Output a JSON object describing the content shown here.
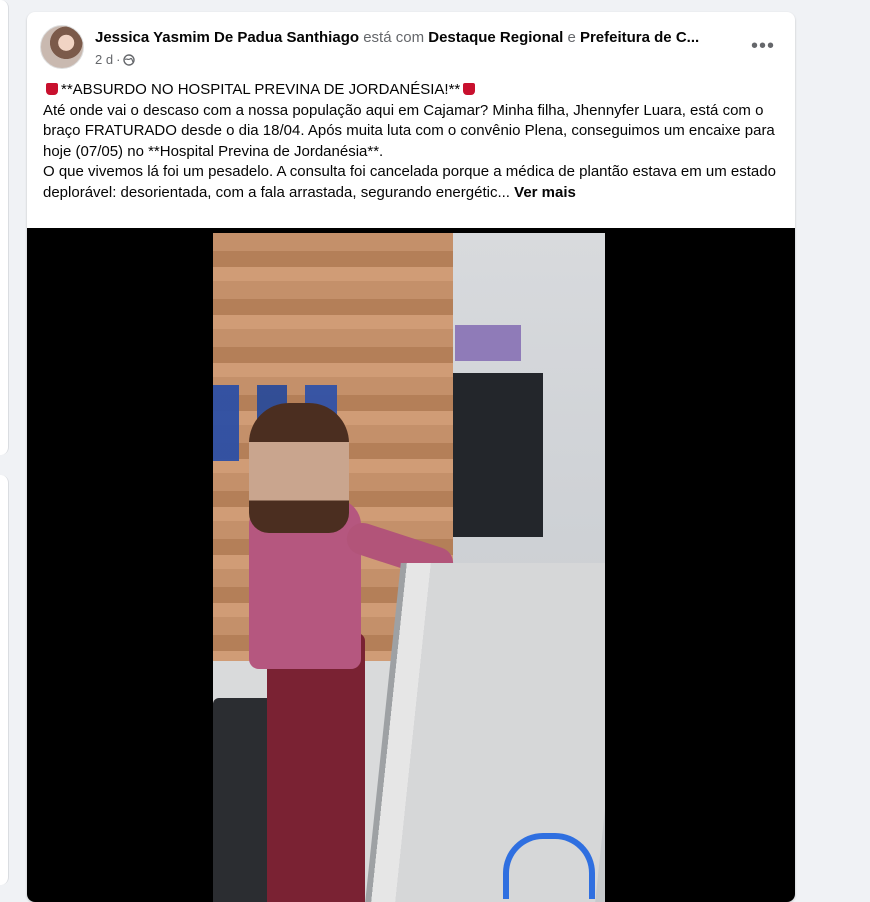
{
  "post": {
    "author": "Jessica Yasmim De Padua Santhiago",
    "with_text": "está com",
    "tag1": "Destaque Regional",
    "and_text": "e",
    "tag2": "Prefeitura de C...",
    "time": "2 d",
    "time_sep": "·",
    "privacy_icon": "globe-icon",
    "more_icon": "more-horizontal-icon",
    "more_label": "•••",
    "headline": "**ABSURDO NO HOSPITAL PREVINA DE JORDANÉSIA!**",
    "paragraph1": "Até onde vai o descaso com a nossa população aqui em Cajamar? Minha filha, Jhennyfer Luara, está com o braço FRATURADO desde o dia 18/04. Após muita luta com o convênio Plena, conseguimos um encaixe para hoje (07/05) no **Hospital Previna de Jordanésia**.",
    "paragraph2": "O que vivemos lá foi um pesadelo. A consulta foi cancelada porque a médica de plantão estava em um estado deplorável: desorientada, com a fala arrastada, segurando energétic...",
    "see_more": "Ver mais"
  },
  "colors": {
    "accent_flag": "#c8102e",
    "text_primary": "#050505",
    "text_secondary": "#65676b",
    "background": "#f0f2f5"
  }
}
